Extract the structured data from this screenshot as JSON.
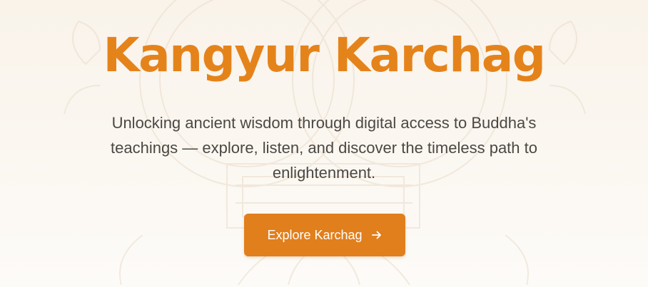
{
  "hero": {
    "title": "Kangyur Karchag",
    "subtitle": "Unlocking ancient wisdom through digital access to Buddha's teachings — explore, listen, and discover the timeless path to enlightenment.",
    "cta_label": "Explore Karchag",
    "cta_icon": "arrow-right-icon"
  },
  "background": {
    "watermark_icon": "dharma-emblem-watermark"
  },
  "colors": {
    "accent": "#e5831b",
    "button": "#e17f1c",
    "text": "#4b4743",
    "background": "#f9f3ea"
  }
}
